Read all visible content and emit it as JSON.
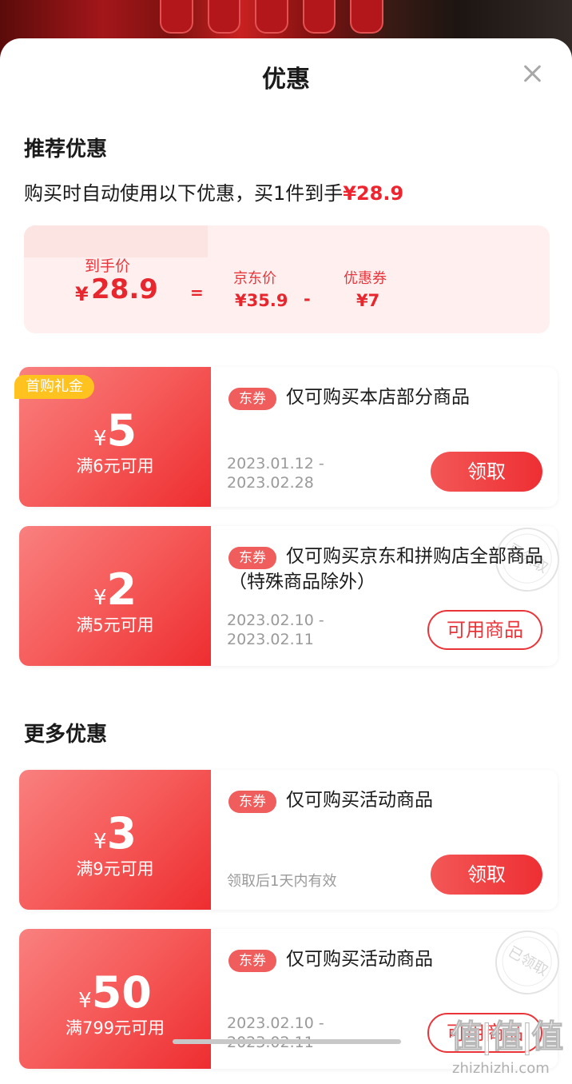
{
  "header": {
    "title": "优惠"
  },
  "recommended": {
    "title": "推荐优惠",
    "subtitle_prefix": "购买时自动使用以下优惠，买1件到手",
    "subtitle_price": "¥28.9",
    "summary": {
      "final_label": "到手价",
      "final_symbol": "¥",
      "final_value": "28.9",
      "equals": "=",
      "jd_label": "京东价",
      "jd_value": "¥35.9",
      "minus": "-",
      "coupon_label": "优惠券",
      "coupon_value": "¥7"
    },
    "coupons": [
      {
        "badge": "首购礼金",
        "symbol": "¥",
        "amount": "5",
        "condition": "满6元可用",
        "tag": "东券",
        "description": "仅可购买本店部分商品",
        "date_start": "2023.01.12  -",
        "date_end": "2023.02.28",
        "button": "领取"
      },
      {
        "symbol": "¥",
        "amount": "2",
        "condition": "满5元可用",
        "tag": "东券",
        "description": "仅可购买京东和拼购店全部商品（特殊商品除外）",
        "date_start": "2023.02.10  -",
        "date_end": "2023.02.11",
        "button": "可用商品",
        "stamp": "已领取"
      }
    ]
  },
  "more": {
    "title": "更多优惠",
    "coupons": [
      {
        "symbol": "¥",
        "amount": "3",
        "condition": "满9元可用",
        "tag": "东券",
        "description": "仅可购买活动商品",
        "validity": "领取后1天内有效",
        "button": "领取"
      },
      {
        "symbol": "¥",
        "amount": "50",
        "condition": "满799元可用",
        "tag": "东券",
        "description": "仅可购买活动商品",
        "date_start": "2023.02.10  -",
        "date_end": "2023.02.11",
        "button": "可用商品",
        "stamp": "已领取"
      }
    ]
  },
  "watermark": {
    "logo": "值|值|值",
    "url": "zhizhizhi.com"
  },
  "colors": {
    "accent": "#ee2f33",
    "summary_bg": "#fff0ef",
    "badge": "#ffc21f"
  }
}
